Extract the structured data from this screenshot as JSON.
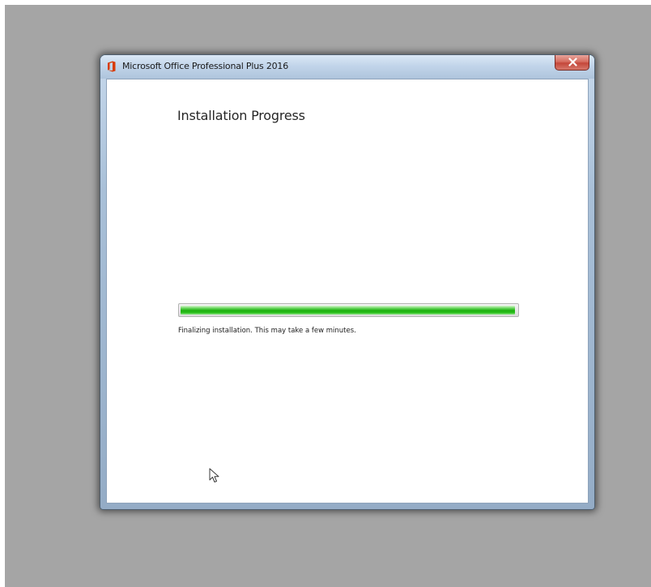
{
  "window": {
    "title": "Microsoft Office Professional Plus 2016",
    "icon": "office-icon",
    "close_icon": "close-icon"
  },
  "content": {
    "heading": "Installation Progress",
    "status_text": "Finalizing installation. This may take a few minutes."
  },
  "progress": {
    "fraction": 0.995
  },
  "cursor": {
    "icon": "mouse-pointer-icon"
  },
  "colors": {
    "desktop": "#a5a5a5",
    "office_brand": "#d83b01",
    "progress_green": "#1caf0d",
    "close_button": "#c4473a"
  }
}
